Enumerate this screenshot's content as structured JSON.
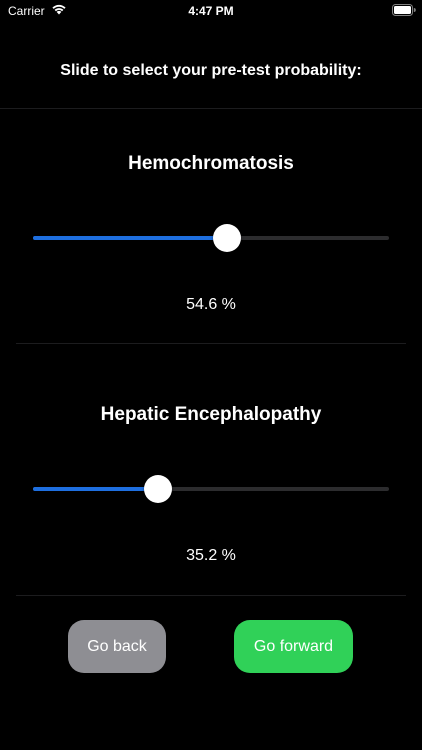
{
  "status_bar": {
    "carrier": "Carrier",
    "time": "4:47 PM",
    "wifi_icon": "wifi-icon",
    "battery_icon": "battery-icon"
  },
  "header": {
    "title": "Slide to select your pre-test probability:"
  },
  "tests": [
    {
      "name": "Hemochromatosis",
      "probability_percent": 54.6,
      "value_label": "54.6 %"
    },
    {
      "name": "Hepatic Encephalopathy",
      "probability_percent": 35.2,
      "value_label": "35.2 %"
    }
  ],
  "buttons": {
    "back_label": "Go back",
    "forward_label": "Go forward"
  },
  "colors": {
    "background": "#000000",
    "slider_fill": "#1e6fe0",
    "slider_track": "#2c2c2e",
    "back_button": "#8e8e93",
    "forward_button": "#30d158"
  }
}
